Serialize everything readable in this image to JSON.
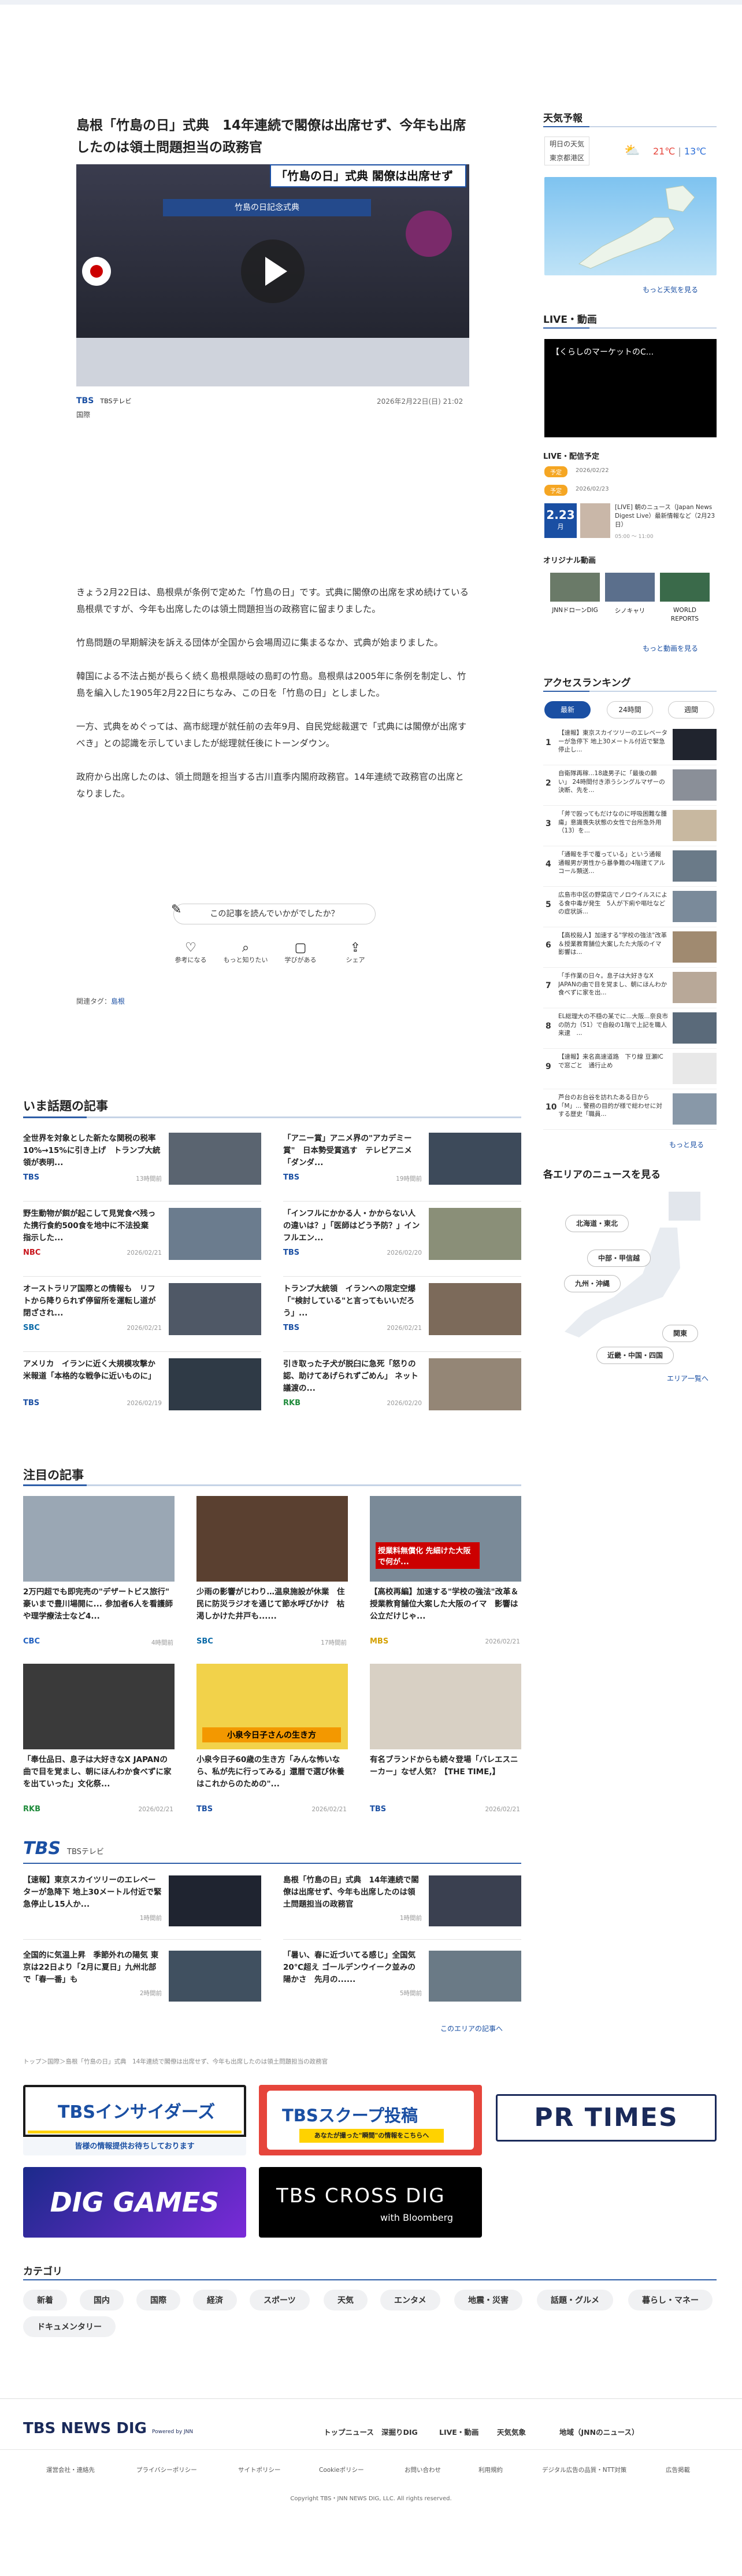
{
  "article": {
    "title": "島根「竹島の日」式典　14年連続で閣僚は出席せず、今年も出席したのは領土問題担当の政務官",
    "video_caption": "「竹島の日」式典 閣僚は出席せず",
    "video_banner": "竹島の日記念式典",
    "source": "TBSテレビ",
    "datetime": "2026年2月22日(日) 21:02",
    "category": "国際",
    "paragraphs": [
      "きょう2月22日は、島根県が条例で定めた「竹島の日」です。式典に閣僚の出席を求め続けている島根県ですが、今年も出席したのは領土問題担当の政務官に留まりました。",
      "竹島問題の早期解決を訴える団体が全国から会場周辺に集まるなか、式典が始まりました。",
      "韓国による不法占拠が長らく続く島根県隠岐の島町の竹島。島根県は2005年に条例を制定し、竹島を編入した1905年2月22日にちなみ、この日を「竹島の日」としました。",
      "一方、式典をめぐっては、高市総理が就任前の去年9月、自民党総裁選で「式典には閣僚が出席すべき」との認識を示していましたが総理就任後にトーンダウン。",
      "政府から出席したのは、領土問題を担当する古川直季内閣府政務官。14年連続で政務官の出席となりました。"
    ],
    "feedback_q": "この記事を読んでいかがでしたか？",
    "reactions": [
      "参考になる",
      "もっと知りたい",
      "学びがある",
      "シェア"
    ],
    "tags_label": "関連タグ：",
    "tag": "島根"
  },
  "sidebar": {
    "weather_title": "天気予報",
    "weather_tomorrow": "明日の天気",
    "weather_area": "東京都港区",
    "temp_high": "21℃",
    "temp_low": "13℃",
    "weather_more": "もっと天気を見る",
    "live_title": "LIVE・動画",
    "live_video_title": "【くらしのマーケットのC...",
    "sched_title": "LIVE・配信予定",
    "sched_badge1": "予定",
    "sched_date1": "2026/02/22",
    "sched_badge2": "予定",
    "sched_date2": "2026/02/23",
    "sched_day": "2.23",
    "sched_dow": "月",
    "sched_item": "[LIVE] 朝のニュース（Japan News Digest Live）最新情報など（2月23日）",
    "sched_time": "05:00 〜 11:00",
    "orig_title": "オリジナル動画",
    "orig_items": [
      "JNNドローンDIG",
      "シノキャリ",
      "WORLD REPORTS"
    ],
    "orig_more": "もっと動画を見る",
    "rank_title": "アクセスランキング",
    "rank_tabs": [
      "最新",
      "24時間",
      "週間"
    ],
    "ranking": [
      "【速報】東京スカイツリーのエレベーターが急停下 地上30メートル付近で緊急停止し...",
      "自衛隊再稼...18歳男子に「最後の願い」 24時間付き添うシングルマザーの決断、先を...",
      "「斧で殴ってもだけなのに呼吸困難な腫瘍」意識喪失状態の女性で台所急外用（13）を...",
      "「通報を手で覆っている」という通報　通報男が男性から暴争難の4階建てアルコール類送...",
      "広島市中区の野菜店でノロウイルスによる食中毒が発生　5人が下痢や嘔吐などの症状訴...",
      "【高校殺人】加速する\"学校の強法\"改革＆授業教育舗位大案したた大阪のイマ　影響は...",
      "「手作業の日々。息子は大好きなX JAPANの曲で目を覚まし、朝にほんわか食べずに家を出...",
      "EL総理大の不穏の某でに...大阪...奈良市の防力（51）で自殺の1階で上記を職人来逮　...",
      "【速報】来名高速道路　下り線 豆瀬ICで窓ごと　通行止め",
      "芦台のお台谷を訪れたある日から「M」... 警務の目的が様で総わせに対する歴史「職員..."
    ],
    "rank_more": "もっと見る",
    "area_title": "各エリアのニュースを見る",
    "areas": [
      "北海道・東北",
      "中部・甲信越",
      "九州・沖縄",
      "関東",
      "近畿・中国・四国"
    ],
    "area_more": "エリア一覧へ"
  },
  "hot": {
    "title": "いま話題の記事",
    "items": [
      {
        "t": "全世界を対象とした新たな関税の税率10%→15%に引き上げ　トランプ大統領が表明...",
        "s": "TBS",
        "d": "13時間前"
      },
      {
        "t": "「アニー賞」アニメ界の\"アカデミー賞\"　日本勢受賞逃す　テレビアニメ「ダンダ...",
        "s": "TBS",
        "d": "19時間前"
      },
      {
        "t": "野生動物が餌が起こして見覚食べ残った携行食約500食を地中に不法投棄　指示した...",
        "s": "NBC",
        "d": "2026/02/21"
      },
      {
        "t": "「インフルにかかる人・かからない人の違いは？」「医師はどう予防？」インフルエン...",
        "s": "TBS",
        "d": "2026/02/20"
      },
      {
        "t": "オーストラリア国際との情報も　リフトから降りられず停留所を運転し道が閉ざされ...",
        "s": "SBC",
        "d": "2026/02/21"
      },
      {
        "t": "トランプ大統領　イランへの限定空爆「\"検討している\"と言ってもいいだろう」...",
        "s": "TBS",
        "d": "2026/02/21"
      },
      {
        "t": "アメリカ　イランに近く大規模攻撃か　米報道「本格的な戦争に近いものに」",
        "s": "TBS",
        "d": "2026/02/19"
      },
      {
        "t": "引き取った子犬が脱臼に急死「怒りの認、助けてあげられずごめん」 ネット議渡の...",
        "s": "RKB",
        "d": "2026/02/20"
      }
    ]
  },
  "featured": {
    "title": "注目の記事",
    "items": [
      {
        "t": "2万円超でも即完売の\"デザートビス旅行\" 豪いまで豊川場開に... 参加者6人を看護師や理学療法士など4...",
        "s": "CBC",
        "d": "4時間前"
      },
      {
        "t": "少雨の影響がじわり…温泉施設が休業　住民に防災ラジオを通じて節水呼びかけ　枯渇しかけた井戸も......",
        "s": "SBC",
        "d": "17時間前"
      },
      {
        "t": "【高校再編】加速する\"学校の強法\"改革＆授業教育舗位大案した大阪のイマ　影響は公立だけじゃ...",
        "s": "MBS",
        "d": "2026/02/21"
      },
      {
        "t": "「奉仕品日、息子は大好きなX JAPANの曲で目を覚まし、朝にほんわか食べずに家を出ていった」文化祭...",
        "s": "RKB",
        "d": "2026/02/21"
      },
      {
        "t": "小泉今日子60歳の生き方「みんな怖いなら、私が先に行ってみる」還暦で選び休養はこれからのための\"...",
        "s": "TBS",
        "d": "2026/02/21"
      },
      {
        "t": "有名ブランドからも続々登場「バレエスニーカー」なぜ人気？【THE TIME,】",
        "s": "TBS",
        "d": "2026/02/21"
      }
    ],
    "feat_label": "授業料無償化 先細けた大阪で何が...",
    "news_label": "小泉今日子さんの生き方"
  },
  "tbs_block": {
    "logo": "TBS",
    "sub": "TBSテレビ",
    "items": [
      {
        "t": "【速報】東京スカイツリーのエレベーターが急降下 地上30メートル付近で緊急停止し15人か...",
        "d": "1時間前"
      },
      {
        "t": "島根「竹島の日」式典　14年連続で閣僚は出席せず、今年も出席したのは領土問題担当の政務官",
        "d": "1時間前"
      },
      {
        "t": "全国的に気温上昇　季節外れの陽気 東京は22日より「2月に夏日」九州北部で「春一番」も",
        "d": "2時間前"
      },
      {
        "t": "「暑い、春に近づいてる感じ」全国気20℃超え ゴールデンウイーク並みの陽かさ　先月の......",
        "d": "5時間前"
      }
    ],
    "more": "このエリアの記事へ"
  },
  "breadcrumb": "トップ＞国際＞島根「竹島の日」式典　14年連続で閣僚は出席せず、今年も出席したのは領土問題担当の政務官",
  "banners": {
    "insiders": "TBSインサイダーズ",
    "insiders_sub": "皆様の情報提供お待ちしております",
    "scoop": "TBSスクープ投稿",
    "scoop_sub": "あなたが撮った\"瞬間\"の情報をこちらへ",
    "prtimes": "PR TIMES",
    "diggames": "DIG GAMES",
    "crossdig": "TBS CROSS DIG",
    "crossdig_sub": "with Bloomberg"
  },
  "categories_title": "カテゴリ",
  "categories": [
    "新着",
    "国内",
    "国際",
    "経済",
    "スポーツ",
    "天気",
    "エンタメ",
    "地震・災害",
    "話題・グルメ",
    "暮らし・マネー",
    "ドキュメンタリー"
  ],
  "footer": {
    "logo": "TBS NEWS DIG",
    "logo_sub": "Powered by JNN",
    "nav": [
      "トップニュース",
      "深掘りDIG",
      "LIVE・動画",
      "天気気象",
      "地域（JNNのニュース）"
    ],
    "links": [
      "運営会社・連絡先",
      "プライバシーポリシー",
      "サイトポリシー",
      "Cookieポリシー",
      "お問い合わせ",
      "利用規約",
      "デジタル広告の品質・NTT対策",
      "広告掲載"
    ],
    "copyright": "Copyright TBS・JNN NEWS DIG, LLC. All rights reserved."
  }
}
